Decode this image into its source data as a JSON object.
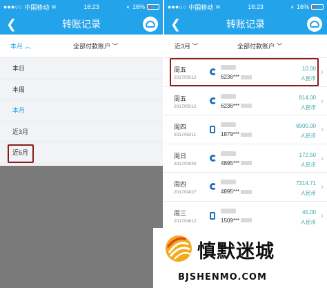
{
  "status": {
    "carrier": "中国移动",
    "time": "16:23",
    "battery": "16%"
  },
  "nav": {
    "title": "转账记录"
  },
  "left": {
    "period": "本月",
    "account": "全部付款账户",
    "options": [
      "本日",
      "本周",
      "本月",
      "近3月",
      "近6月"
    ]
  },
  "right": {
    "period": "近3月",
    "account": "全部付款账户",
    "records": [
      {
        "day": "周五",
        "date": "2017/05/12",
        "account": "6236***",
        "amount": "10.00",
        "currency": "人民币"
      },
      {
        "day": "周五",
        "date": "2017/05/12",
        "account": "6236***",
        "amount": "814.00",
        "currency": "人民币"
      },
      {
        "day": "周四",
        "date": "2017/05/11",
        "account": "1879***",
        "amount": "6500.00",
        "currency": "人民币"
      },
      {
        "day": "周日",
        "date": "2017/04/30",
        "account": "4895***",
        "amount": "172.50",
        "currency": "人民币"
      },
      {
        "day": "周四",
        "date": "2017/04/27",
        "account": "4895***",
        "amount": "7314.71",
        "currency": "人民币"
      },
      {
        "day": "周三",
        "date": "2017/04/12",
        "account": "1509***",
        "amount": "45.00",
        "currency": "人民币"
      }
    ]
  },
  "watermark": {
    "cn": "慎默迷城",
    "en": "BJSHENMO.COM"
  },
  "colors": {
    "accent": "#23a3e9",
    "highlight": "#8e1b1b",
    "amount": "#3da5a8"
  }
}
